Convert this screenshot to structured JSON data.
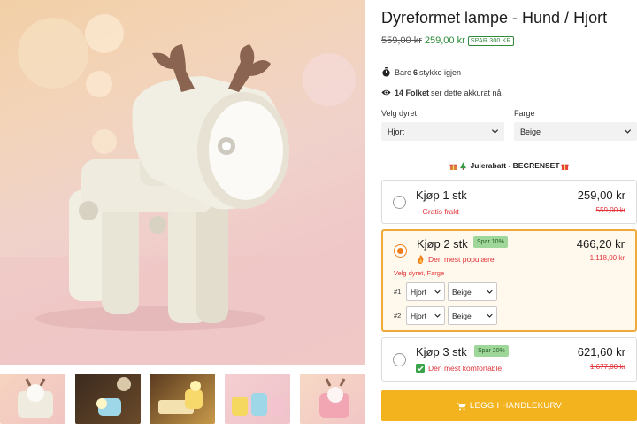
{
  "product": {
    "title": "Dyreformet lampe - Hund / Hjort",
    "old_price": "559,00 kr",
    "new_price": "259,00 kr",
    "save_badge": "SPAR 300 KR"
  },
  "stock": {
    "prefix": "Bare",
    "count": "6",
    "suffix": "stykke igjen"
  },
  "viewers": {
    "count": "14 Folket",
    "suffix": "ser dette akkurat nå"
  },
  "options": {
    "animal_label": "Velg dyret",
    "animal_value": "Hjort",
    "color_label": "Farge",
    "color_value": "Beige"
  },
  "promo": {
    "text": "Julerabatt - BEGRENSET"
  },
  "offers": [
    {
      "title": "Kjøp 1 stk",
      "subtitle": "+ Gratis frakt",
      "price": "259,00 kr",
      "old_price": "559,00 kr"
    },
    {
      "title": "Kjøp 2 stk",
      "badge": "Spar 10%",
      "subtitle": "Den mest populære",
      "price": "466,20 kr",
      "old_price": "1.118,00 kr",
      "variant_label": "Velg dyret, Farge",
      "variants": [
        {
          "num": "#1",
          "animal": "Hjort",
          "color": "Beige"
        },
        {
          "num": "#2",
          "animal": "Hjort",
          "color": "Beige"
        }
      ]
    },
    {
      "title": "Kjøp 3 stk",
      "badge": "Spar 20%",
      "subtitle": "Den mest komfortable",
      "price": "621,60 kr",
      "old_price": "1.677,00 kr"
    }
  ],
  "cart": {
    "label": "LEGG I HANDLEKURV"
  },
  "colors": {
    "accent": "#f3b31f",
    "selected_border": "#f0a93b",
    "radio_on": "#f07d1a",
    "sale_green": "#2e8b3a",
    "warn_red": "#e0343a"
  },
  "icons": [
    "stopwatch-icon",
    "eye-icon",
    "chevron-down-icon",
    "gift-icon",
    "tree-icon",
    "fire-icon",
    "checkbox-icon",
    "cart-icon"
  ]
}
